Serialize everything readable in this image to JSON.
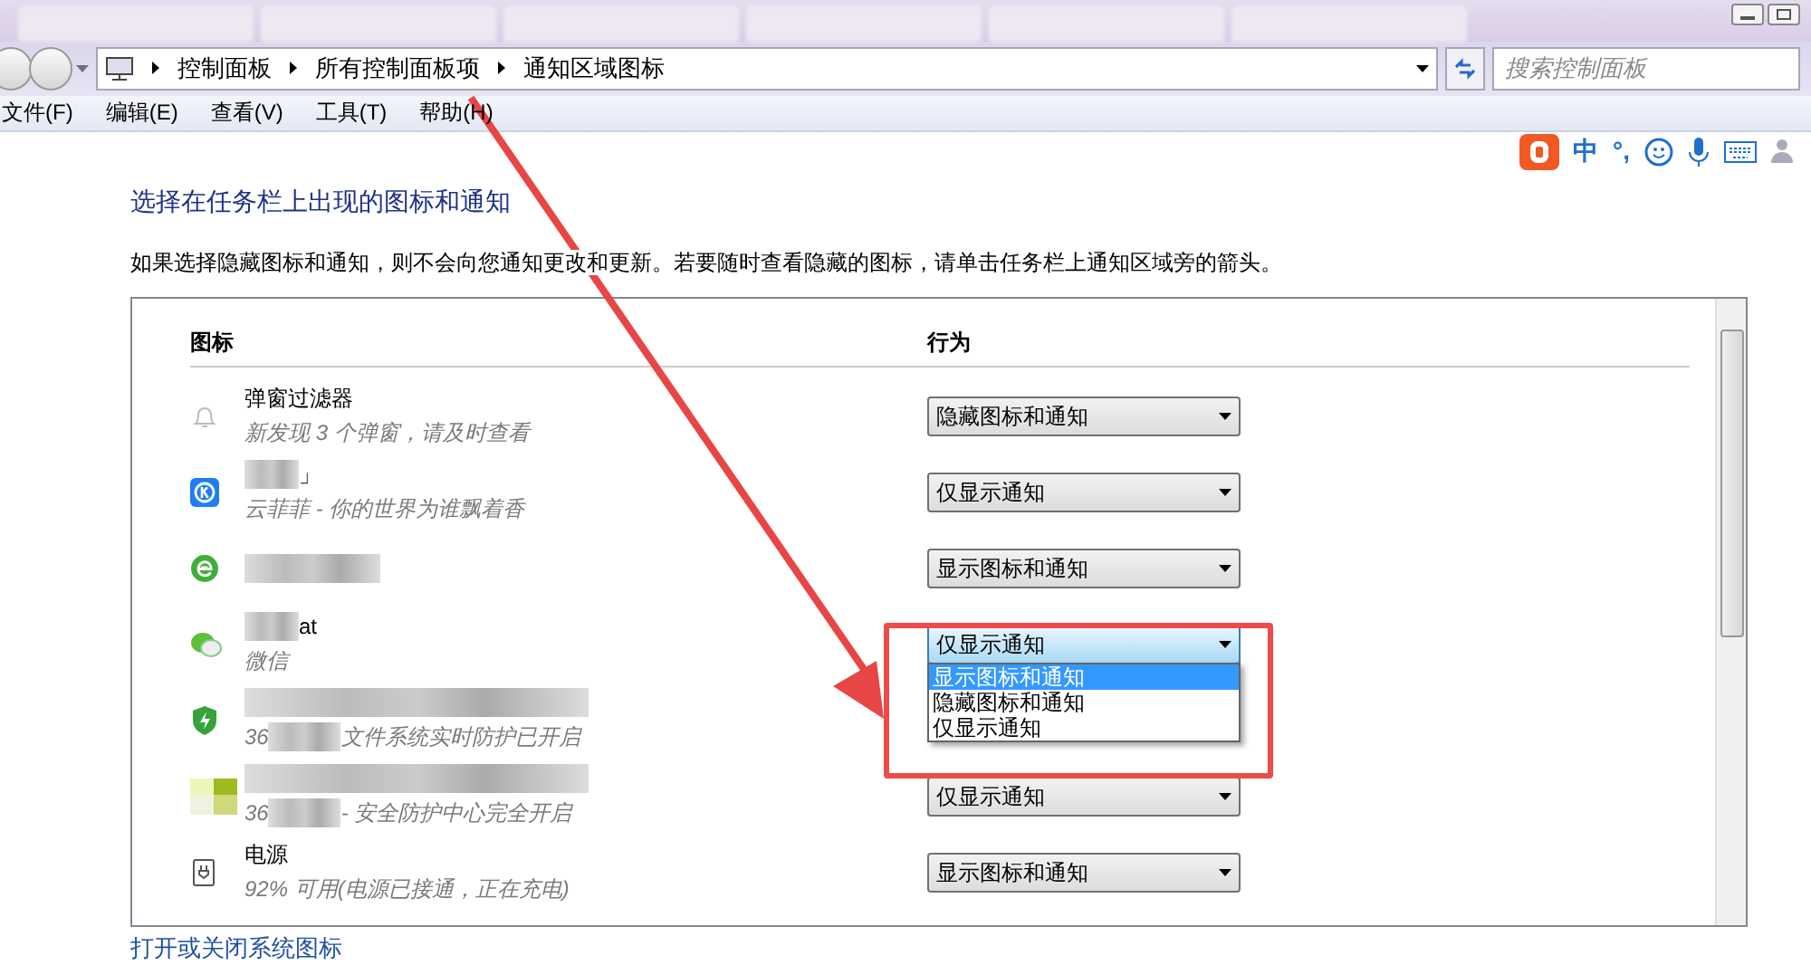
{
  "address_bar": {
    "crumbs": [
      "控制面板",
      "所有控制面板项",
      "通知区域图标"
    ],
    "search": {
      "placeholder": "搜索控制面板"
    }
  },
  "menu": [
    "文件(F)",
    "编辑(E)",
    "查看(V)",
    "工具(T)",
    "帮助(H)"
  ],
  "ime": {
    "mode": "中",
    "punct": "°,"
  },
  "heading": "选择在任务栏上出现的图标和通知",
  "description": "如果选择隐藏图标和通知，则不会向您通知更改和更新。若要随时查看隐藏的图标，请单击任务栏上通知区域旁的箭头。",
  "table": {
    "columns": [
      "图标",
      "行为"
    ],
    "rows": [
      {
        "kind": "bell",
        "name": "弹窗过滤器",
        "name_blurred": false,
        "desc_prefix": "",
        "desc_blurred": false,
        "desc": "新发现 3 个弹窗，请及时查看",
        "behavior": "隐藏图标和通知",
        "open": false
      },
      {
        "kind": "k",
        "name": "」",
        "name_blurred": true,
        "desc_prefix": "",
        "desc_blurred": false,
        "desc": "云菲菲 - 你的世界为谁飘着香",
        "behavior": "仅显示通知",
        "open": false
      },
      {
        "kind": "e",
        "name": "",
        "name_blurred": true,
        "desc_prefix": "",
        "desc_blurred": false,
        "desc": "",
        "behavior": "显示图标和通知",
        "open": false
      },
      {
        "kind": "chat",
        "name": "at",
        "name_blurred": true,
        "desc_prefix": "",
        "desc_blurred": false,
        "desc": "微信",
        "behavior": "仅显示通知",
        "open": true,
        "options": [
          {
            "label": "显示图标和通知",
            "selected": true
          },
          {
            "label": "隐藏图标和通知",
            "selected": false
          },
          {
            "label": "仅显示通知",
            "selected": false
          }
        ]
      },
      {
        "kind": "shield",
        "name": "",
        "name_blurred": true,
        "desc_prefix": "36",
        "desc_blurred": true,
        "desc": "文件系统实时防护已开启",
        "open": false
      },
      {
        "kind": "tiles",
        "name": "",
        "name_blurred": true,
        "desc_prefix": "36",
        "desc_blurred": true,
        "desc": "- 安全防护中心完全开启",
        "behavior": "仅显示通知",
        "open": false
      },
      {
        "kind": "power",
        "name": "电源",
        "name_blurred": false,
        "desc_prefix": "",
        "desc_blurred": false,
        "desc": "92% 可用(电源已接通，正在充电)",
        "behavior": "显示图标和通知",
        "open": false
      }
    ]
  },
  "link": "打开或关闭系统图标"
}
